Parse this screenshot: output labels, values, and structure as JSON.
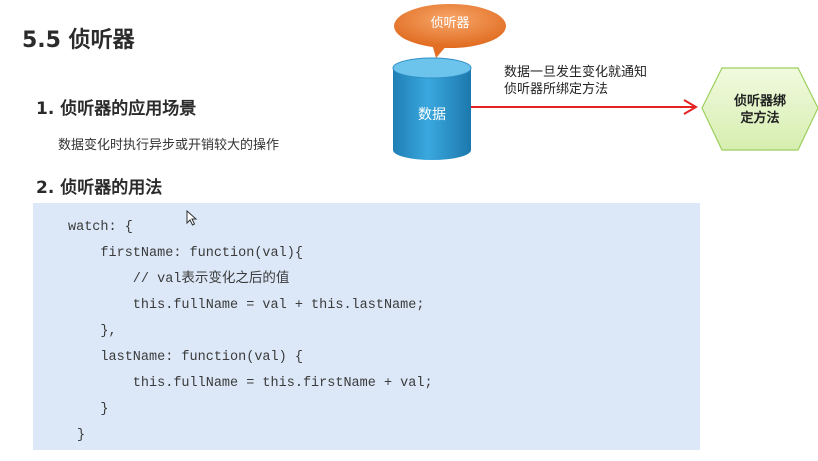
{
  "slide": {
    "title": "5.5 侦听器",
    "section_1_heading": "1. 侦听器的应用场景",
    "section_1_desc": "数据变化时执行异步或开销较大的操作",
    "section_2_heading": "2. 侦听器的用法"
  },
  "diagram": {
    "bubble_label": "侦听器",
    "database_label": "数据",
    "arrow_text_line1": "数据一旦发生变化就通知",
    "arrow_text_line2": "侦听器所绑定方法",
    "hexagon_line1": "侦听器绑",
    "hexagon_line2": "定方法",
    "colors": {
      "bubble": "#ed7d31",
      "database": "#2e9bd3",
      "arrow": "#e52222",
      "hexagon_fill": "#e6f5c9",
      "hexagon_stroke": "#9ccf5e",
      "code_background": "#dce8f8"
    }
  },
  "code": {
    "lines": [
      "watch: {",
      "    firstName: function(val){",
      "        // val表示变化之后的值",
      "        this.fullName = val + this.lastName;",
      "    },",
      "    lastName: function(val) {",
      "        this.fullName = this.firstName + val;",
      "    }",
      "}"
    ]
  },
  "icons": {
    "cursor": "mouse-pointer-icon"
  }
}
